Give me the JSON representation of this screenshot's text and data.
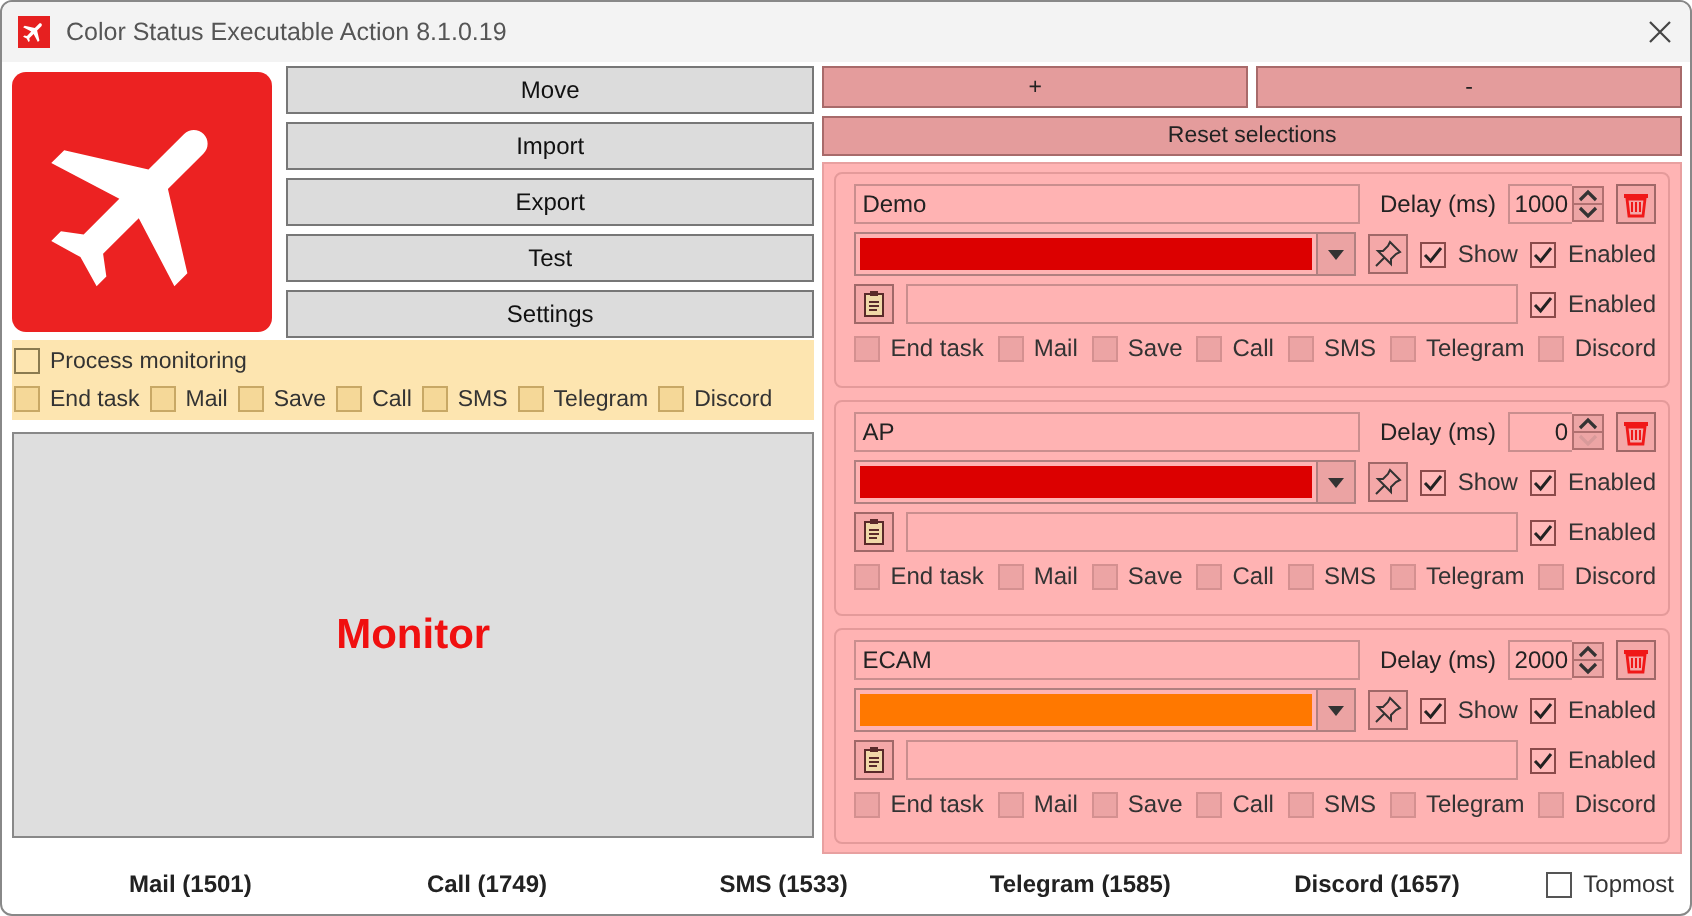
{
  "window": {
    "title": "Color Status Executable Action 8.1.0.19"
  },
  "buttons": [
    "Move",
    "Import",
    "Export",
    "Test",
    "Settings"
  ],
  "process_monitoring": {
    "label": "Process monitoring",
    "checked": false
  },
  "actions": [
    {
      "label": "End task",
      "checked": false
    },
    {
      "label": "Mail",
      "checked": false
    },
    {
      "label": "Save",
      "checked": false
    },
    {
      "label": "Call",
      "checked": false
    },
    {
      "label": "SMS",
      "checked": false
    },
    {
      "label": "Telegram",
      "checked": false
    },
    {
      "label": "Discord",
      "checked": false
    }
  ],
  "monitor": {
    "text": "Monitor"
  },
  "top_buttons": [
    "+",
    "-"
  ],
  "reset_button": "Reset selections",
  "entries": [
    {
      "name": "Demo",
      "delay_label": "Delay (ms)",
      "delay": "1000",
      "down_disabled": false,
      "color": "#dc0000",
      "show": {
        "label": "Show",
        "checked": true
      },
      "enabled": {
        "label": "Enabled",
        "checked": true
      },
      "command_enabled": {
        "label": "Enabled",
        "checked": true
      },
      "actions": [
        {
          "label": "End task",
          "checked": false
        },
        {
          "label": "Mail",
          "checked": false
        },
        {
          "label": "Save",
          "checked": false
        },
        {
          "label": "Call",
          "checked": false
        },
        {
          "label": "SMS",
          "checked": false
        },
        {
          "label": "Telegram",
          "checked": false
        },
        {
          "label": "Discord",
          "checked": false
        }
      ]
    },
    {
      "name": "AP",
      "delay_label": "Delay (ms)",
      "delay": "0",
      "down_disabled": true,
      "color": "#dc0000",
      "show": {
        "label": "Show",
        "checked": true
      },
      "enabled": {
        "label": "Enabled",
        "checked": true
      },
      "command_enabled": {
        "label": "Enabled",
        "checked": true
      },
      "actions": [
        {
          "label": "End task",
          "checked": false
        },
        {
          "label": "Mail",
          "checked": false
        },
        {
          "label": "Save",
          "checked": false
        },
        {
          "label": "Call",
          "checked": false
        },
        {
          "label": "SMS",
          "checked": false
        },
        {
          "label": "Telegram",
          "checked": false
        },
        {
          "label": "Discord",
          "checked": false
        }
      ]
    },
    {
      "name": "ECAM",
      "delay_label": "Delay (ms)",
      "delay": "2000",
      "down_disabled": false,
      "color": "#ff7800",
      "show": {
        "label": "Show",
        "checked": true
      },
      "enabled": {
        "label": "Enabled",
        "checked": true
      },
      "command_enabled": {
        "label": "Enabled",
        "checked": true
      },
      "actions": [
        {
          "label": "End task",
          "checked": false
        },
        {
          "label": "Mail",
          "checked": false
        },
        {
          "label": "Save",
          "checked": false
        },
        {
          "label": "Call",
          "checked": false
        },
        {
          "label": "SMS",
          "checked": false
        },
        {
          "label": "Telegram",
          "checked": false
        },
        {
          "label": "Discord",
          "checked": false
        }
      ]
    }
  ],
  "status_bar": {
    "counters": [
      "Mail (1501)",
      "Call (1749)",
      "SMS (1533)",
      "Telegram (1585)",
      "Discord (1657)"
    ],
    "topmost": {
      "label": "Topmost",
      "checked": false
    }
  }
}
